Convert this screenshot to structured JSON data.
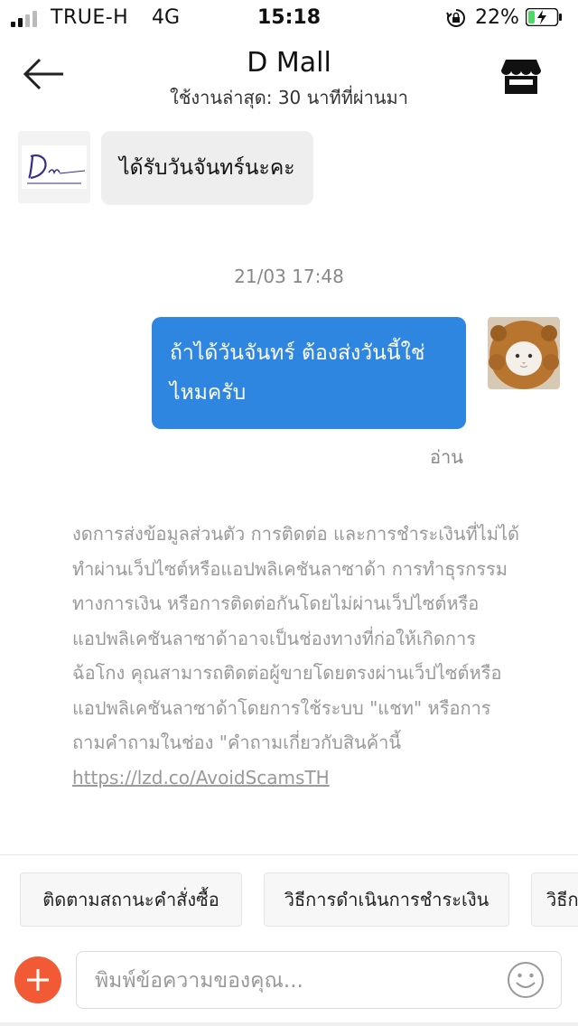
{
  "status_bar": {
    "carrier": "TRUE-H",
    "network": "4G",
    "time": "15:18",
    "battery_percent": "22%",
    "battery_level": 0.22,
    "icons": [
      "signal-icon",
      "orientation-lock-icon",
      "battery-charging-icon"
    ]
  },
  "header": {
    "title": "D Mall",
    "subtitle": "ใช้งานล่าสุด: 30 นาทีที่ผ่านมา",
    "icons": [
      "back-arrow-icon",
      "store-icon"
    ]
  },
  "messages": [
    {
      "direction": "incoming",
      "sender": "shop",
      "text": "ได้รับวันจันทร์นะคะ"
    },
    {
      "direction": "outgoing",
      "sender": "me",
      "text": "ถ้าได้วันจันทร์ ต้องส่งวันนี้ใช่ไหมครับ",
      "status": "อ่าน"
    }
  ],
  "timestamp": "21/03 17:48",
  "disclaimer": {
    "text": "งดการส่งข้อมูลส่วนตัว การติดต่อ และการชำระเงินที่ไม่ได้ทำผ่านเว็ปไซต์หรือแอปพลิเคชันลาซาด้า การทำธุรกรรมทางการเงิน หรือการติดต่อกันโดยไม่ผ่านเว็ปไซต์หรือแอปพลิเคชันลาซาด้าอาจเป็นช่องทางที่ก่อให้เกิดการฉ้อโกง คุณสามารถติดต่อผู้ขายโดยตรงผ่านเว็ปไซต์หรือแอปพลิเคชันลาซาด้าโดยการใช้ระบบ \"แชท\" หรือการถามคำถามในช่อง \"คำถามเกี่ยวกับสินค้านี้ ",
    "link": "https://lzd.co/AvoidScamsTH"
  },
  "quick_replies": [
    "ติดตามสถานะคำสั่งซื้อ",
    "วิธีการดำเนินการชำระเงิน",
    "วิธีก"
  ],
  "input": {
    "placeholder": "พิมพ์ข้อความของคุณ...",
    "value": ""
  },
  "colors": {
    "outgoing_bubble": "#2f86e0",
    "incoming_bubble": "#eeeeee",
    "plus_button": "#f15a35",
    "battery_green": "#4cd964"
  }
}
